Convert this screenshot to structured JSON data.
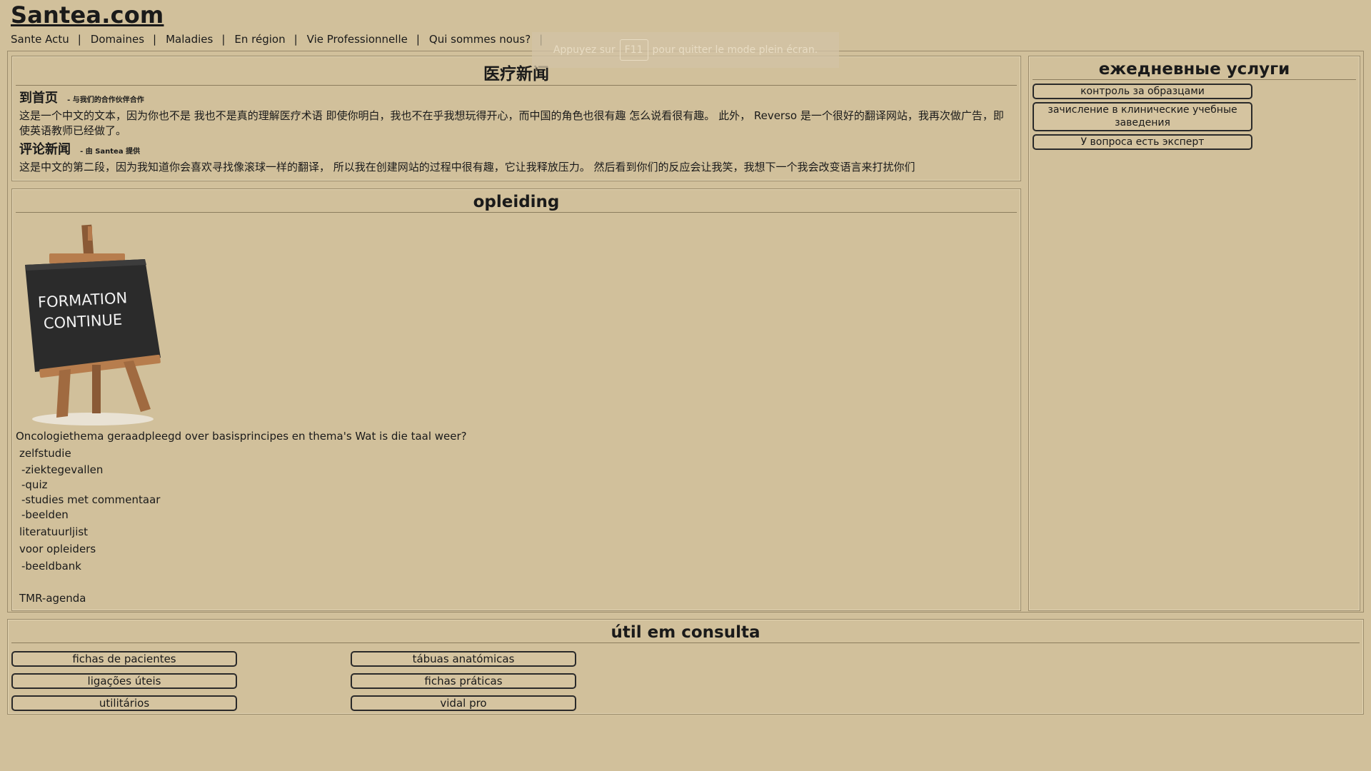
{
  "site": {
    "title": "Santea.com"
  },
  "nav": {
    "items": [
      {
        "label": "Sante Actu"
      },
      {
        "label": "Domaines"
      },
      {
        "label": "Maladies"
      },
      {
        "label": "En région"
      },
      {
        "label": "Vie Professionnelle"
      },
      {
        "label": "Qui sommes nous?"
      }
    ],
    "separator": "|"
  },
  "fullscreen_notice": {
    "before": "Appuyez sur",
    "key": "F11",
    "after": "pour quitter le mode plein écran."
  },
  "news": {
    "title": "医疗新闻",
    "items": [
      {
        "heading": "到首页",
        "byline": "- 与我们的合作伙伴合作",
        "text": "这是一个中文的文本，因为你也不是 我也不是真的理解医疗术语 即使你明白，我也不在乎我想玩得开心，而中国的角色也很有趣 怎么说看很有趣。 此外， Reverso 是一个很好的翻译网站，我再次做广告，即使英语教师已经做了。"
      },
      {
        "heading": "评论新闻",
        "byline": "- 由 Santea 提供",
        "text": "这是中文的第二段，因为我知道你会喜欢寻找像滚球一样的翻译， 所以我在创建网站的过程中很有趣，它让我释放压力。 然后看到你们的反应会让我笑，我想下一个我会改变语言来打扰你们"
      }
    ]
  },
  "training": {
    "title": "opleiding",
    "image_text": [
      "FORMATION",
      "CONTINUE"
    ],
    "intro": "Oncologiethema geraadpleegd over basisprincipes en thema's Wat is die taal weer?",
    "self_study": "zelfstudie",
    "self_study_items": [
      "-ziektegevallen",
      "-quiz",
      "-studies met commentaar",
      "-beelden"
    ],
    "literature": "literatuurljist",
    "trainers": "voor opleiders",
    "trainers_items": [
      "-beeldbank"
    ],
    "agenda": "TMR-agenda"
  },
  "daily_services": {
    "title": "ежедневные услуги",
    "buttons": [
      {
        "label": "контроль за образцами"
      },
      {
        "label": "зачисление в клинические учебные заведения"
      },
      {
        "label": "У вопроса есть эксперт"
      }
    ]
  },
  "consult": {
    "title": "útil em consulta",
    "buttons": [
      {
        "label": "fichas de pacientes"
      },
      {
        "label": "tábuas anatómicas"
      },
      {
        "label": "ligações úteis"
      },
      {
        "label": "fichas práticas"
      },
      {
        "label": "utilitários"
      },
      {
        "label": "vidal pro"
      }
    ]
  },
  "colors": {
    "background": "#d1c09b",
    "border": "#9a8b6b",
    "text": "#1a1a1a"
  }
}
